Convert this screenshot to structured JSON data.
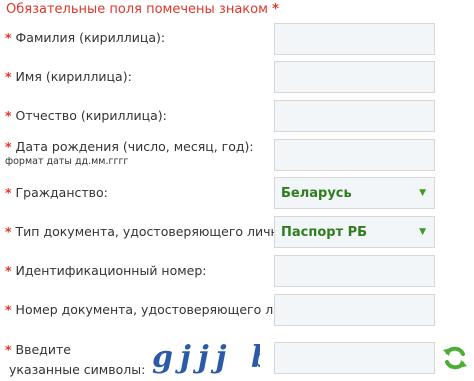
{
  "form": {
    "required_notice": "Обязательные поля помечены знаком",
    "required_mark": "*",
    "fields": [
      {
        "label": "Фамилия (кириллица):",
        "value": ""
      },
      {
        "label": "Имя (кириллица):",
        "value": ""
      },
      {
        "label": "Отчество (кириллица):",
        "value": ""
      },
      {
        "label": "Дата рождения (число, месяц, год):",
        "hint": "формат даты дд.мм.гггг",
        "value": ""
      },
      {
        "label": "Гражданство:",
        "selected": "Беларусь"
      },
      {
        "label": "Тип документа, удостоверяющего личность:",
        "selected": "Паспорт РБ"
      },
      {
        "label": "Идентификационный номер:",
        "value": ""
      },
      {
        "label": "Номер документа, удостоверяющего личность:",
        "value": ""
      }
    ],
    "captcha": {
      "label_line1": "Введите",
      "label_line2": "указанные символы:",
      "text": "gjjj b",
      "value": ""
    }
  },
  "colors": {
    "required": "#e0352b",
    "select_text": "#2f7d1f",
    "captcha_text": "#2a5aa8",
    "refresh": "#4caf35"
  },
  "icons": {
    "dropdown": "triangle-down-icon",
    "refresh": "refresh-icon",
    "captcha": "captcha-image"
  }
}
